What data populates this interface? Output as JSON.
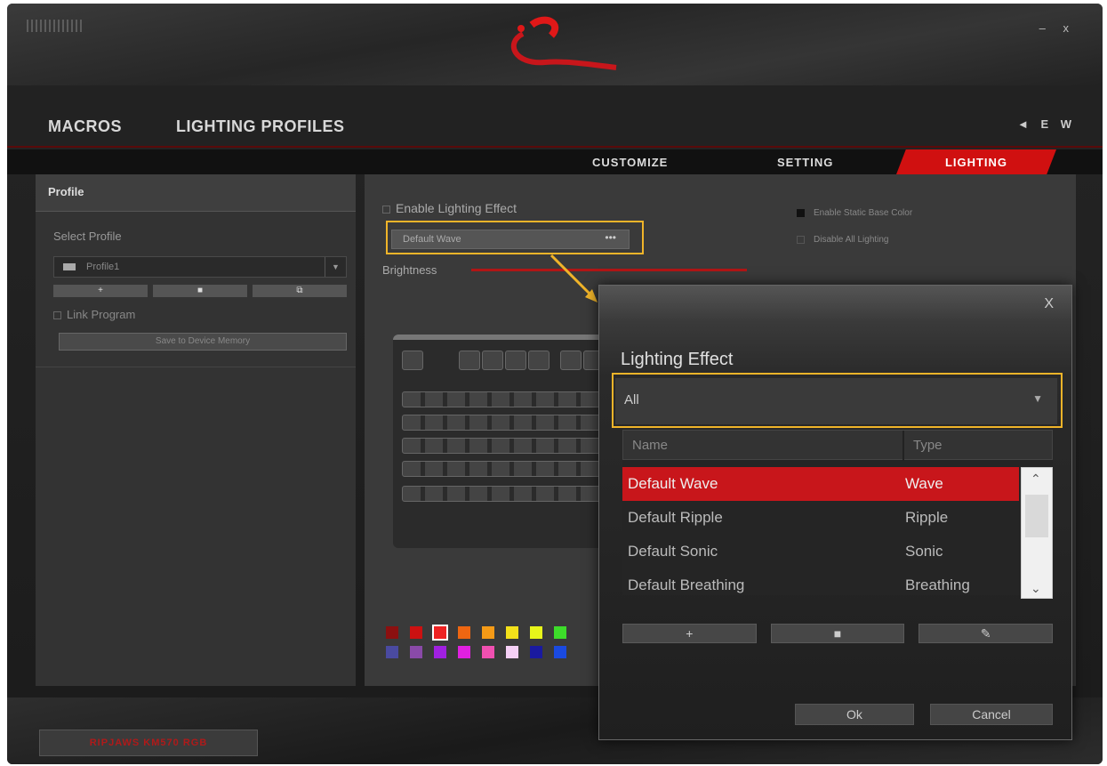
{
  "window": {
    "controls": "– x"
  },
  "topnav": {
    "macros": "MACROS",
    "lighting_profiles": "LIGHTING PROFILES",
    "lang": "◄ E W"
  },
  "subtabs": {
    "customize": "CUSTOMIZE",
    "setting": "SETTING",
    "lighting": "LIGHTING"
  },
  "profile": {
    "header": "Profile",
    "select_label": "Select Profile",
    "selected": "Profile1",
    "buttons": [
      "+",
      "■",
      "⧉"
    ],
    "link_program": "Link Program",
    "save_button": "Save to Device Memory"
  },
  "lighting": {
    "enable_label": "Enable Lighting Effect",
    "effect_selected": "Default Wave",
    "effect_more": "•••",
    "brightness_label": "Brightness",
    "brightness_level": 1.0,
    "enable_static_base": "Enable Static Base Color",
    "disable_all": "Disable All Lighting"
  },
  "palette": [
    "#8b1010",
    "#cc1111",
    "#ee2222",
    "#ee6611",
    "#f59a16",
    "#f3e01a",
    "#e8f51a",
    "#3ddc2a",
    "#4a4aa0",
    "#8a4aa8",
    "#a020e0",
    "#e020e0",
    "#f050b0",
    "#f5d0f5",
    "#1a1aa0",
    "#1a4ae0"
  ],
  "palette_selected_index": 2,
  "dialog": {
    "close": "X",
    "title": "Lighting Effect",
    "filter": "All",
    "filter_icon": "caret-down-icon",
    "columns": {
      "name": "Name",
      "type": "Type"
    },
    "rows": [
      {
        "name": "Default Wave",
        "type": "Wave"
      },
      {
        "name": "Default Ripple",
        "type": "Ripple"
      },
      {
        "name": "Default Sonic",
        "type": "Sonic"
      },
      {
        "name": "Default Breathing",
        "type": "Breathing"
      }
    ],
    "selected_row": 0,
    "action_add": "+",
    "action_delete": "■",
    "action_edit": "✎",
    "ok": "Ok",
    "cancel": "Cancel"
  },
  "footer": {
    "brand": "RIPJAWS KM570 RGB"
  },
  "colors": {
    "accent": "#c8161b",
    "highlight": "#f0b429"
  }
}
